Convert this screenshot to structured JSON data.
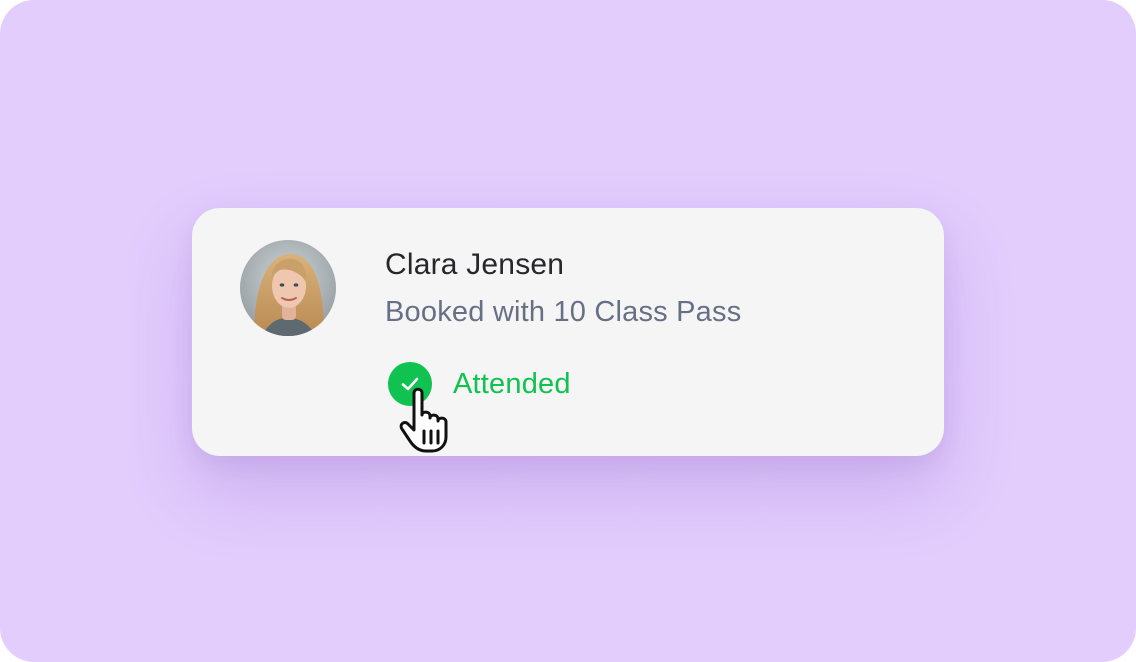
{
  "booking": {
    "client_name": "Clara Jensen",
    "booking_info": "Booked with 10 Class Pass",
    "status_label": "Attended",
    "status_icon": "check-circle-icon"
  },
  "colors": {
    "background": "#e2cdfd",
    "card": "#f5f5f5",
    "status_green": "#10c24f",
    "name_text": "#27272a",
    "subtitle_text": "#667085"
  },
  "cursor": "hand-pointer-icon"
}
